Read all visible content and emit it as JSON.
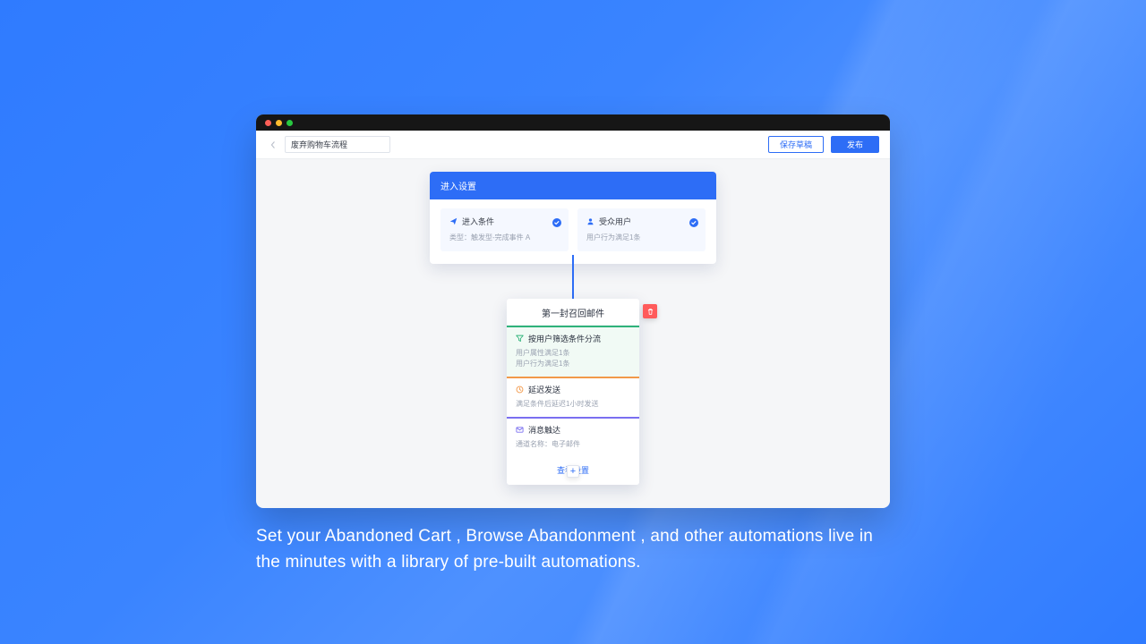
{
  "toolbar": {
    "flow_title": "废弃购物车流程",
    "save_draft": "保存草稿",
    "publish": "发布"
  },
  "entry": {
    "header": "进入设置",
    "left": {
      "title": "进入条件",
      "desc": "类型：触发型-完成事件 A"
    },
    "right": {
      "title": "受众用户",
      "desc": "用户行为满足1条"
    }
  },
  "step": {
    "title": "第一封召回邮件",
    "filter": {
      "title": "按用户筛选条件分流",
      "line1": "用户属性满足1条",
      "line2": "用户行为满足1条"
    },
    "delay": {
      "title": "延迟发送",
      "line1": "满足条件后延迟1小时发送"
    },
    "touch": {
      "title": "消息触达",
      "line1": "通道名称：电子邮件"
    },
    "view": "查看设置"
  },
  "caption": "Set your Abandoned Cart , Browse Abandonment , and other automations live in the minutes with a library of pre-built automations."
}
